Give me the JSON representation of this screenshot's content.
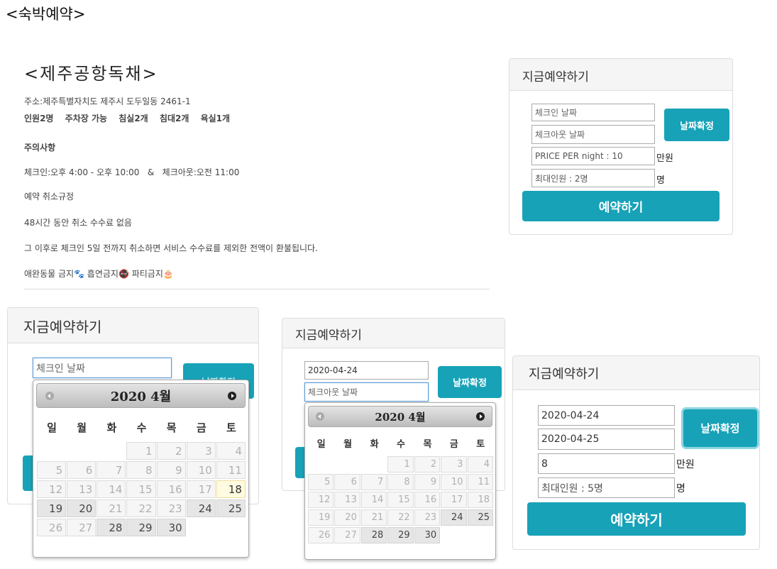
{
  "page": {
    "title": "<숙박예약>",
    "lodging_name": "<제주공항독채>",
    "address": "주소:제주특별자치도 제주시 도두일동 2461-1",
    "amenities": [
      "인원2명",
      "주차장 가능",
      "침실2개",
      "침대2개",
      "욕실1개"
    ],
    "notice_title": "주의사항",
    "check_times": "체크인:오후 4:00 - 오후 10:00   &   체크아웃:오전 11:00",
    "cancel_title": "예약 취소규정",
    "cancel_rule_1": "48시간 동안 취소 수수료 없음",
    "cancel_rule_2": "그 이후로 체크인 5일 전까지 취소하면 서비스 수수료를 제외한 전액이 환불됩니다.",
    "rules": "애완동물 금지🐾 흡연금지🚭 파티금지🎂"
  },
  "booking_panels": [
    {
      "header": "지금예약하기",
      "checkin_placeholder": "체크인 날짜",
      "checkout_placeholder": "체크아웃 날짜",
      "price_value": "PRICE PER night : 10",
      "price_unit": "만원",
      "guests_value": "최대인원 : 2명",
      "guests_unit": "명",
      "confirm_button": "날짜확정",
      "reserve_button": "예약하기"
    },
    {
      "header": "지금예약하기",
      "checkin_placeholder": "체크인 날짜",
      "confirm_button": "날짜확정"
    },
    {
      "header": "지금예약하기",
      "checkin_value": "2020-04-24",
      "checkout_placeholder": "체크아웃 날짜",
      "confirm_button": "날짜확정"
    },
    {
      "header": "지금예약하기",
      "checkin_value": "2020-04-24",
      "checkout_value": "2020-04-25",
      "price_value": "8",
      "price_unit": "만원",
      "guests_value": "최대인원 : 5명",
      "guests_unit": "명",
      "confirm_button": "날짜확정",
      "reserve_button": "예약하기"
    }
  ],
  "datepickers": [
    {
      "title": "2020 4월",
      "weekdays": [
        "일",
        "월",
        "화",
        "수",
        "목",
        "금",
        "토"
      ],
      "leading_blanks": 3,
      "days": [
        {
          "d": "1",
          "s": "disabled"
        },
        {
          "d": "2",
          "s": "disabled"
        },
        {
          "d": "3",
          "s": "disabled"
        },
        {
          "d": "4",
          "s": "disabled"
        },
        {
          "d": "5",
          "s": "disabled"
        },
        {
          "d": "6",
          "s": "disabled"
        },
        {
          "d": "7",
          "s": "disabled"
        },
        {
          "d": "8",
          "s": "disabled"
        },
        {
          "d": "9",
          "s": "disabled"
        },
        {
          "d": "10",
          "s": "disabled"
        },
        {
          "d": "11",
          "s": "disabled"
        },
        {
          "d": "12",
          "s": "disabled"
        },
        {
          "d": "13",
          "s": "disabled"
        },
        {
          "d": "14",
          "s": "disabled"
        },
        {
          "d": "15",
          "s": "disabled"
        },
        {
          "d": "16",
          "s": "disabled"
        },
        {
          "d": "17",
          "s": "disabled"
        },
        {
          "d": "18",
          "s": "today"
        },
        {
          "d": "19",
          "s": "enabled"
        },
        {
          "d": "20",
          "s": "enabled"
        },
        {
          "d": "21",
          "s": "disabled"
        },
        {
          "d": "22",
          "s": "disabled"
        },
        {
          "d": "23",
          "s": "disabled"
        },
        {
          "d": "24",
          "s": "enabled"
        },
        {
          "d": "25",
          "s": "enabled"
        },
        {
          "d": "26",
          "s": "disabled"
        },
        {
          "d": "27",
          "s": "disabled"
        },
        {
          "d": "28",
          "s": "enabled"
        },
        {
          "d": "29",
          "s": "enabled"
        },
        {
          "d": "30",
          "s": "enabled"
        }
      ]
    },
    {
      "title": "2020 4월",
      "weekdays": [
        "일",
        "월",
        "화",
        "수",
        "목",
        "금",
        "토"
      ],
      "leading_blanks": 3,
      "days": [
        {
          "d": "1",
          "s": "disabled"
        },
        {
          "d": "2",
          "s": "disabled"
        },
        {
          "d": "3",
          "s": "disabled"
        },
        {
          "d": "4",
          "s": "disabled"
        },
        {
          "d": "5",
          "s": "disabled"
        },
        {
          "d": "6",
          "s": "disabled"
        },
        {
          "d": "7",
          "s": "disabled"
        },
        {
          "d": "8",
          "s": "disabled"
        },
        {
          "d": "9",
          "s": "disabled"
        },
        {
          "d": "10",
          "s": "disabled"
        },
        {
          "d": "11",
          "s": "disabled"
        },
        {
          "d": "12",
          "s": "disabled"
        },
        {
          "d": "13",
          "s": "disabled"
        },
        {
          "d": "14",
          "s": "disabled"
        },
        {
          "d": "15",
          "s": "disabled"
        },
        {
          "d": "16",
          "s": "disabled"
        },
        {
          "d": "17",
          "s": "disabled"
        },
        {
          "d": "18",
          "s": "disabled"
        },
        {
          "d": "19",
          "s": "disabled"
        },
        {
          "d": "20",
          "s": "disabled"
        },
        {
          "d": "21",
          "s": "disabled"
        },
        {
          "d": "22",
          "s": "disabled"
        },
        {
          "d": "23",
          "s": "disabled"
        },
        {
          "d": "24",
          "s": "enabled"
        },
        {
          "d": "25",
          "s": "enabled"
        },
        {
          "d": "26",
          "s": "disabled"
        },
        {
          "d": "27",
          "s": "disabled"
        },
        {
          "d": "28",
          "s": "enabled"
        },
        {
          "d": "29",
          "s": "enabled"
        },
        {
          "d": "30",
          "s": "enabled"
        }
      ]
    }
  ],
  "colors": {
    "accent": "#17a2b8",
    "panel_header_bg": "#f5f5f5",
    "border": "#dddddd",
    "today_bg": "#fffbe0",
    "enabled_day_bg": "#e6e6e6",
    "disabled_day_bg": "#f6f6f6"
  }
}
